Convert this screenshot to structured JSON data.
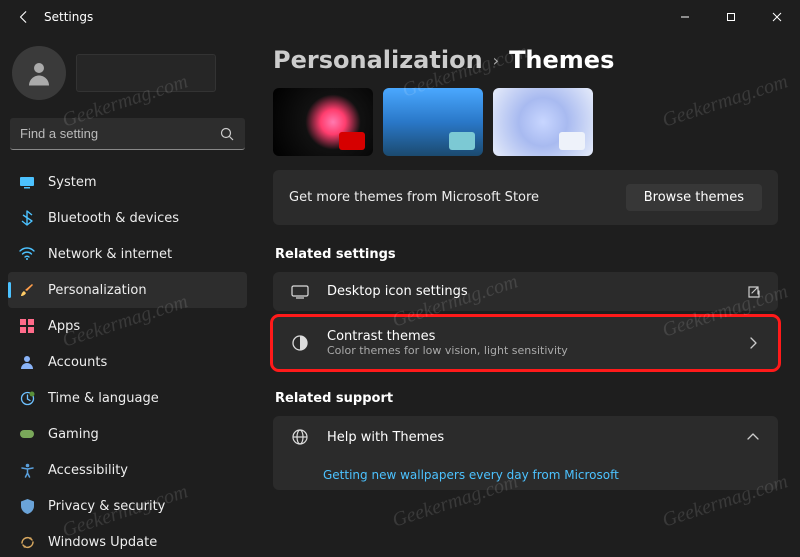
{
  "window": {
    "title": "Settings"
  },
  "search": {
    "placeholder": "Find a setting"
  },
  "nav": {
    "items": [
      {
        "label": "System"
      },
      {
        "label": "Bluetooth & devices"
      },
      {
        "label": "Network & internet"
      },
      {
        "label": "Personalization"
      },
      {
        "label": "Apps"
      },
      {
        "label": "Accounts"
      },
      {
        "label": "Time & language"
      },
      {
        "label": "Gaming"
      },
      {
        "label": "Accessibility"
      },
      {
        "label": "Privacy & security"
      },
      {
        "label": "Windows Update"
      }
    ]
  },
  "breadcrumb": {
    "parent": "Personalization",
    "current": "Themes"
  },
  "store": {
    "text": "Get more themes from Microsoft Store",
    "button": "Browse themes"
  },
  "sections": {
    "related_settings": "Related settings",
    "related_support": "Related support"
  },
  "tiles": {
    "desktop_icon": {
      "title": "Desktop icon settings"
    },
    "contrast": {
      "title": "Contrast themes",
      "subtitle": "Color themes for low vision, light sensitivity"
    },
    "help": {
      "title": "Help with Themes"
    }
  },
  "support_link": "Getting new wallpapers every day from Microsoft",
  "watermark": "Geekermag.com"
}
